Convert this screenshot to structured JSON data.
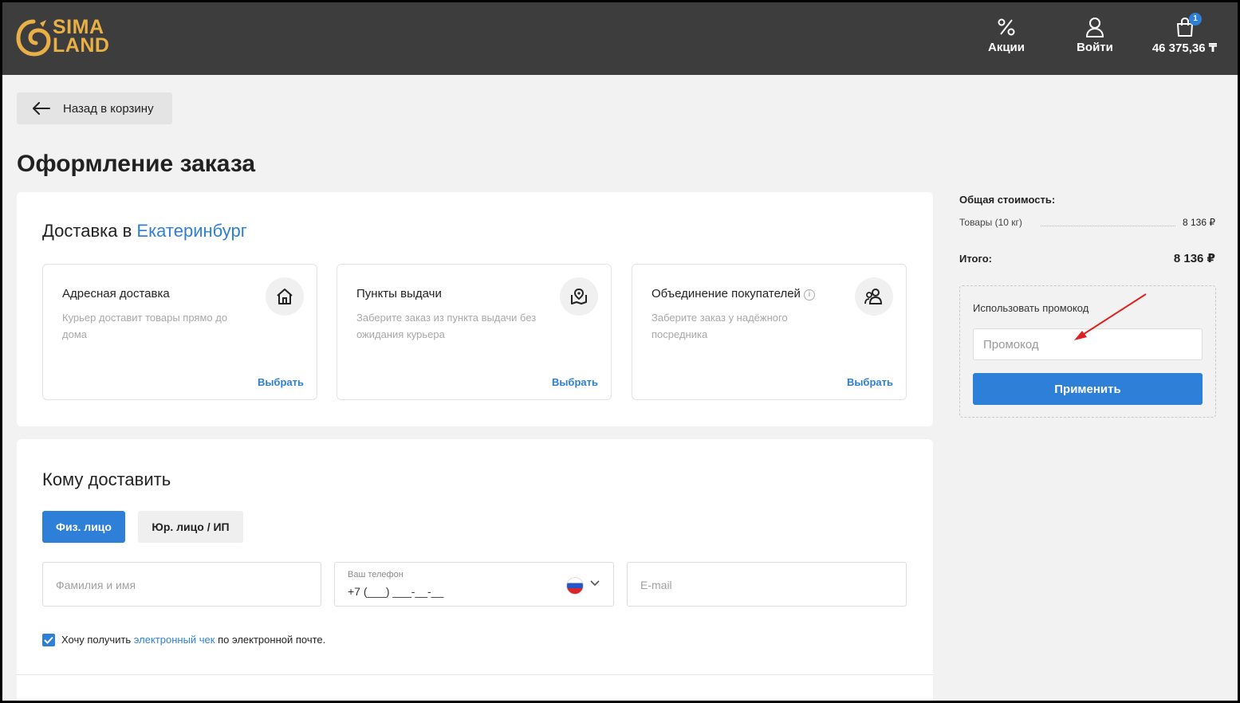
{
  "header": {
    "logo_line1": "SIMA",
    "logo_line2": "LAND",
    "promo_label": "Акции",
    "login_label": "Войти",
    "cart_total": "46 375,36 ₸",
    "cart_badge": "1",
    "icons": [
      "percent-icon",
      "user-icon",
      "bag-icon"
    ]
  },
  "back_button": "Назад в корзину",
  "page_title": "Оформление заказа",
  "delivery": {
    "title_prefix": "Доставка в ",
    "city": "Екатеринбург",
    "options": [
      {
        "title": "Адресная доставка",
        "desc": "Курьер доставит товары прямо до дома",
        "action": "Выбрать",
        "icon": "home-icon"
      },
      {
        "title": "Пункты выдачи",
        "desc": "Заберите заказ из пункта выдачи без ожидания курьера",
        "action": "Выбрать",
        "icon": "map-pin-icon"
      },
      {
        "title": "Объединение покупателей",
        "desc": "Заберите заказ у надёжного посредника",
        "action": "Выбрать",
        "icon": "people-icon"
      }
    ]
  },
  "recipient": {
    "title": "Кому доставить",
    "tab_individual": "Физ. лицо",
    "tab_legal": "Юр. лицо / ИП",
    "name_placeholder": "Фамилия и имя",
    "phone_label": "Ваш телефон",
    "phone_value": "+7 (___) ___-__-__",
    "email_placeholder": "E-mail",
    "receipt_prefix": "Хочу получить ",
    "receipt_link": "электронный чек",
    "receipt_suffix": " по электронной почте."
  },
  "summary": {
    "total_cost_label": "Общая стоимость:",
    "goods_label": "Товары (10 кг)",
    "goods_value": "8 136 ₽",
    "total_label": "Итого:",
    "total_value": "8 136 ₽",
    "promo_title": "Использовать промокод",
    "promo_placeholder": "Промокод",
    "promo_apply": "Применить"
  },
  "colors": {
    "header_bg": "#3d3d3d",
    "accent": "#2d7fd8",
    "logo": "#e8b046",
    "annotation": "#e02020"
  }
}
